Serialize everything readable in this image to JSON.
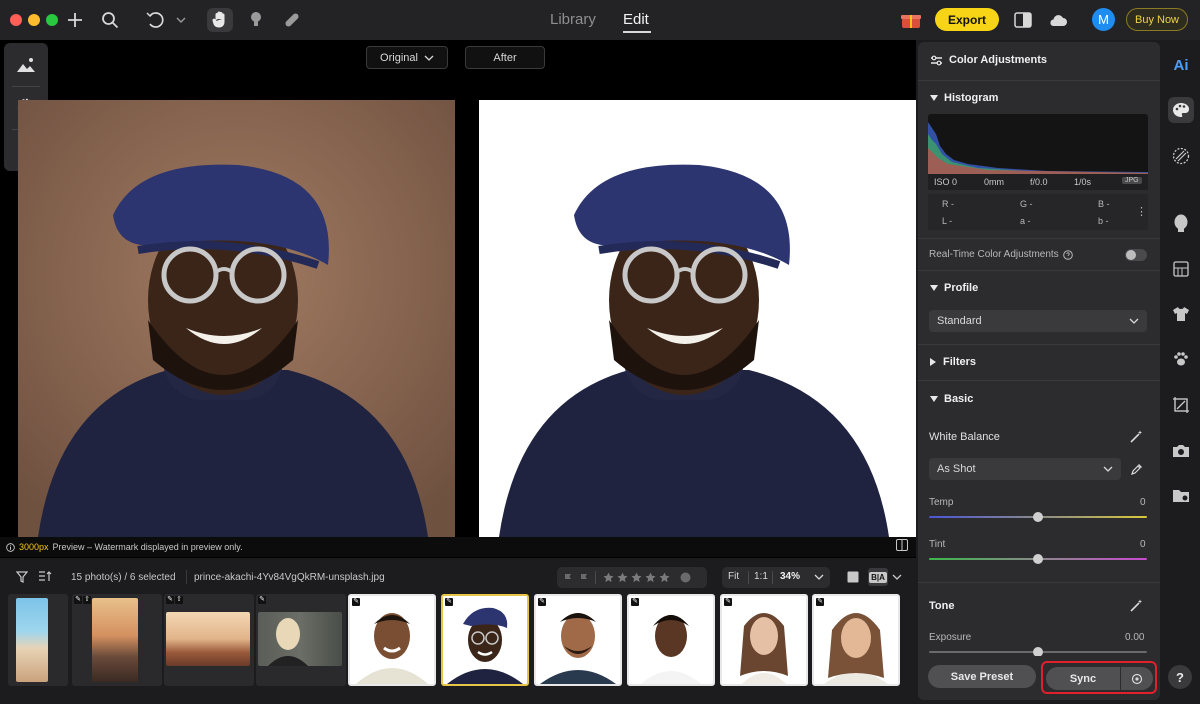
{
  "toolbar": {
    "modes": [
      {
        "label": "Library",
        "active": false
      },
      {
        "label": "Edit",
        "active": true
      }
    ],
    "export_label": "Export",
    "avatar_initial": "M",
    "buy_label": "Buy Now",
    "icons": [
      "add-icon",
      "search-icon",
      "undo-icon",
      "hand-icon",
      "stamp-icon",
      "bandage-icon"
    ]
  },
  "canvas": {
    "before_view_label": "Original",
    "after_view_label": "After",
    "preview_note_size": "3000px",
    "preview_note_text": "Preview – Watermark displayed in preview only."
  },
  "filmbar": {
    "count_text": "15 photo(s) / 6 selected",
    "filename": "prince-akachi-4Yv84VgQkRM-unsplash.jpg",
    "fit_label": "Fit",
    "one_to_one_label": "1:1",
    "zoom": "34%",
    "compare_label": "B|A",
    "rating_stars": 5
  },
  "panel": {
    "title": "Color Adjustments",
    "histogram_title": "Histogram",
    "exif": {
      "iso": "ISO 0",
      "focal": "0mm",
      "aperture": "f/0.0",
      "shutter": "1/0s",
      "format": "JPG"
    },
    "readout": {
      "r": "R -",
      "g": "G -",
      "b": "B -",
      "l": "L -",
      "a": "a -",
      "bb": "b -"
    },
    "realtime_label": "Real-Time Color Adjustments",
    "realtime_on": false,
    "profile_title": "Profile",
    "profile_value": "Standard",
    "filters_title": "Filters",
    "basic_title": "Basic",
    "white_balance_label": "White Balance",
    "white_balance_value": "As Shot",
    "temp_label": "Temp",
    "temp_value": "0",
    "tint_label": "Tint",
    "tint_value": "0",
    "tone_title": "Tone",
    "exposure_label": "Exposure",
    "exposure_value": "0.00",
    "save_preset_label": "Save Preset",
    "sync_label": "Sync"
  },
  "rail": {
    "ai_label": "Ai",
    "icons": [
      "palette-icon",
      "texture-icon",
      "face-icon",
      "grid-icon",
      "shirt-icon",
      "paw-icon",
      "crop-icon",
      "camera-icon",
      "folder-icon"
    ]
  },
  "help_label": "?",
  "colors": {
    "accent": "#f7d416",
    "highlight": "#e0202a",
    "avatar": "#1e8cf0"
  }
}
